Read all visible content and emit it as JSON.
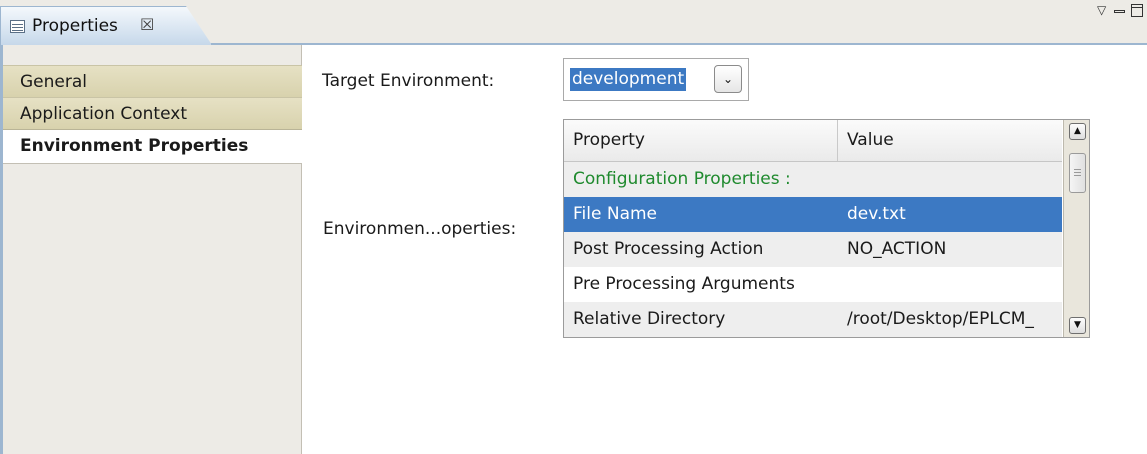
{
  "view": {
    "tab_title": "Properties",
    "close_glyph": "☒",
    "menu_glyph": "▽",
    "icons": [
      "properties-view-icon",
      "close-icon",
      "view-menu-icon",
      "minimize-icon",
      "maximize-icon"
    ]
  },
  "sidebar": {
    "items": [
      {
        "label": "General",
        "active": false
      },
      {
        "label": "Application Context",
        "active": false
      },
      {
        "label": "Environment Properties",
        "active": true
      }
    ]
  },
  "form": {
    "target_env_label": "Target Environment:",
    "target_env_value": "development",
    "dropdown_glyph": "⌄",
    "env_props_label": "Environmen...operties:"
  },
  "table": {
    "columns": [
      "Property",
      "Value"
    ],
    "rows": [
      {
        "property": "Configuration Properties :",
        "value": "",
        "kind": "section"
      },
      {
        "property": "File Name",
        "value": "dev.txt",
        "kind": "selected"
      },
      {
        "property": "Post Processing Action",
        "value": "NO_ACTION",
        "kind": "alt"
      },
      {
        "property": "Pre Processing Arguments",
        "value": "",
        "kind": "normal"
      },
      {
        "property": "Relative Directory",
        "value": "/root/Desktop/EPLCM_",
        "kind": "alt"
      }
    ],
    "scroll_up_glyph": "▲",
    "scroll_down_glyph": "▼"
  },
  "colors": {
    "selection": "#3c79c3",
    "section_text": "#1f8a2e",
    "sidebar_tab": "#d8d2ad",
    "chrome": "#edebe6"
  }
}
